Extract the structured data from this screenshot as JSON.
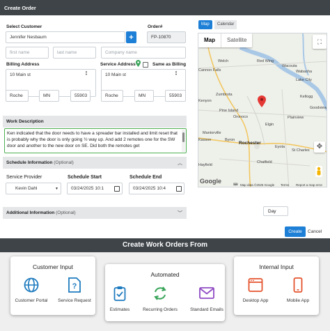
{
  "window": {
    "title": "Create Order"
  },
  "form": {
    "select_customer_label": "Select Customer",
    "customer_value": "Jennifer Nesbaum",
    "order_label": "Order#",
    "order_value": "FP-10870",
    "first_name_placeholder": "first name",
    "last_name_placeholder": "last name",
    "company_placeholder": "Company name",
    "billing_label": "Billing Address",
    "billing_street": "10 Main st",
    "billing_city": "Roche",
    "billing_state": "MN",
    "billing_zip": "55903",
    "service_label": "Service Address",
    "same_as_billing_label": "Same as Billing",
    "service_street": "10 Main st",
    "service_city": "Roche",
    "service_state": "MN",
    "service_zip": "55903"
  },
  "work_description": {
    "header": "Work Description",
    "text": "Ken indicated that the door needs to have a spreader  bar installed and limit reset that is probably why the door is only going ½ way up.  And add 2 remotes one for the SW door and another to the new door on SE.  Did both the remotes get"
  },
  "schedule": {
    "header": "Schedule Information",
    "header_optional": "(Optional)",
    "provider_label": "Service Provider",
    "provider_value": "Kevin Dahl",
    "start_label": "Schedule Start",
    "start_value": "03/24/2025 10:1",
    "end_label": "Schedule End",
    "end_value": "03/24/2025 10:4"
  },
  "additional": {
    "header": "Additional Information",
    "header_optional": "(Optional)"
  },
  "map": {
    "tab_map": "Map",
    "tab_calendar": "Calendar",
    "btn_map": "Map",
    "btn_satellite": "Satellite",
    "towns": [
      "Welch",
      "Red Wing",
      "Wacouta",
      "Cannon Falls",
      "Lake City",
      "Zumbrota",
      "Kenyon",
      "Pine Island",
      "Oronoco",
      "Plainview",
      "Mantorville",
      "Kasson",
      "Byron",
      "Rochester",
      "Eyota",
      "St Charles",
      "Chatfield",
      "Hayfield",
      "Elgin",
      "Kellogg",
      "Goodview",
      "Wabasha"
    ],
    "logo": "Google",
    "footer_data": "Map data ©2025 Google",
    "footer_terms": "Terms",
    "footer_report": "Report a map error",
    "calendar_view": "Day"
  },
  "actions": {
    "create": "Create",
    "cancel": "Cancel"
  },
  "work_orders": {
    "title": "Create Work Orders From",
    "groups": [
      {
        "title": "Customer Input",
        "items": [
          "Customer Portal",
          "Service Request"
        ]
      },
      {
        "title": "Automated",
        "items": [
          "Estimates",
          "Recurring Orders",
          "Standard Emails"
        ]
      },
      {
        "title": "Internal Input",
        "items": [
          "Desktop App",
          "Mobile App"
        ]
      }
    ]
  },
  "colors": {
    "accent": "#1e7fd6",
    "title_bar": "#3f4448",
    "customer_icons": "#1f7bbf",
    "automated_estimates": "#1f7bbf",
    "automated_recurring": "#3aa55a",
    "automated_emails": "#8e4bc4",
    "internal_icons": "#e5532d"
  }
}
